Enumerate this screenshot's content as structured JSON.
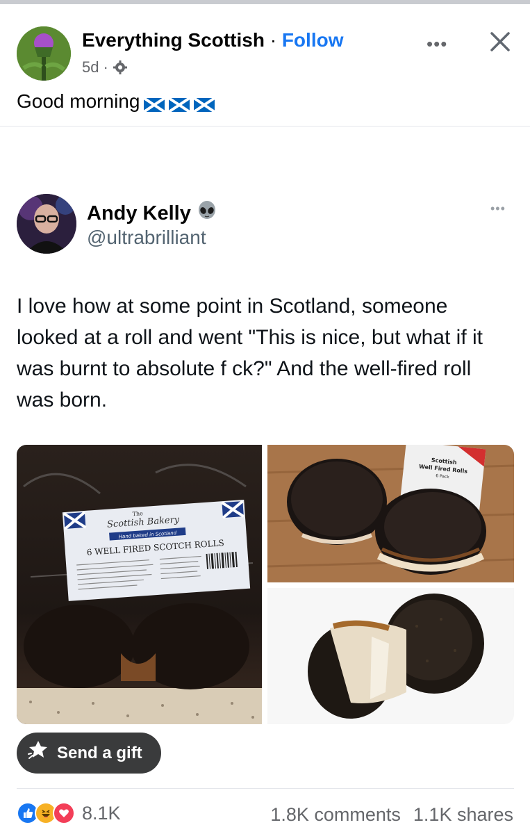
{
  "post": {
    "page_name": "Everything Scottish",
    "separator": " · ",
    "follow_label": "Follow",
    "time": "5d",
    "meta_separator": "·",
    "more_label": "•••",
    "caption": "Good morning"
  },
  "tweet": {
    "name": "Andy Kelly",
    "handle": "@ultrabrilliant",
    "more_label": "•••",
    "text": "I love how at some point in Scotland, someone looked at a roll and went \"This is nice, but what if it was burnt to absolute f  ck?\" And the well-fired roll was born."
  },
  "photos": {
    "left": {
      "brand_small": "The",
      "brand": "Scottish Bakery",
      "sub": "Hand baked in Scotland",
      "product": "6 WELL FIRED SCOTCH ROLLS"
    },
    "top_right": {
      "label_line1": "Scottish",
      "label_line2": "Well Fired Rolls",
      "label_line3": "6 Pack"
    }
  },
  "actions": {
    "gift_label": "Send a gift"
  },
  "footer": {
    "reaction_count": "8.1K",
    "comments": "1.8K comments",
    "shares": "1.1K shares"
  },
  "colors": {
    "accent": "#1877f2",
    "secondary_text": "#65676b",
    "like": "#1877f2",
    "love": "#f33e58",
    "haha": "#f7b125"
  }
}
